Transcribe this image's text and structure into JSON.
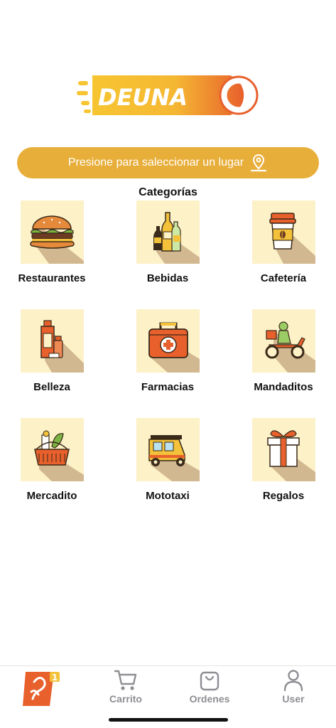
{
  "brand": {
    "logo_text_a": "DEUNA",
    "logo_text_b": "GO"
  },
  "location_button": {
    "label": "Presione para saleccionar un lugar",
    "icon": "map-pin-icon"
  },
  "categories_title": "Categorías",
  "categories": [
    {
      "label": "Restaurantes",
      "icon": "burger-icon"
    },
    {
      "label": "Bebidas",
      "icon": "bottles-icon"
    },
    {
      "label": "Cafetería",
      "icon": "coffee-cup-icon"
    },
    {
      "label": "Belleza",
      "icon": "cosmetics-icon"
    },
    {
      "label": "Farmacias",
      "icon": "first-aid-kit-icon"
    },
    {
      "label": "Mandaditos",
      "icon": "delivery-scooter-icon"
    },
    {
      "label": "Mercadito",
      "icon": "grocery-basket-icon"
    },
    {
      "label": "Mototaxi",
      "icon": "mototaxi-icon"
    },
    {
      "label": "Regalos",
      "icon": "gift-icon"
    }
  ],
  "tabbar": {
    "home_badge": "1",
    "tabs": [
      {
        "label": "",
        "icon": "home-logo-icon"
      },
      {
        "label": "Carrito",
        "icon": "cart-icon"
      },
      {
        "label": "Ordenes",
        "icon": "bag-icon"
      },
      {
        "label": "User",
        "icon": "user-icon"
      }
    ]
  },
  "colors": {
    "accent": "#e8ae3a",
    "tile_bg": "#fdf1c7",
    "tile_shadow": "#d2b891",
    "brand_orange": "#e8602c",
    "brand_yellow": "#f7c531"
  }
}
